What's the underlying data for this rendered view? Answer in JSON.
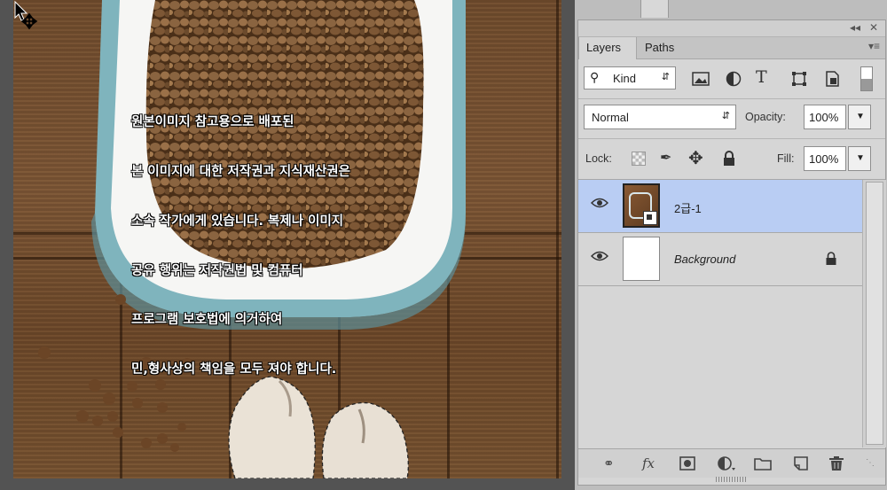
{
  "canvas": {
    "watermark_lines": [
      "원본이미지 참고용으로 배포된",
      "본 이미지에 대한 저작권과 지식재산권은",
      "소속 작가에게 있습니다. 복제나 이미지",
      "공유 행위는 저작권법 및 컴퓨터",
      "프로그램 보호법에 의거하여",
      "민,형사상의 책임을 모두 져야 합니다."
    ]
  },
  "panel": {
    "collapse_glyph": "◂◂",
    "close_glyph": "✕",
    "tabs": [
      {
        "label": "Layers",
        "active": true
      },
      {
        "label": "Paths",
        "active": false
      }
    ],
    "menu_glyph": "▾≡",
    "filter": {
      "kind_label": "Kind",
      "icons": [
        "image-filter-icon",
        "adjustment-filter-icon",
        "type-filter-icon",
        "shape-filter-icon",
        "smart-object-filter-icon"
      ]
    },
    "blend_mode": "Normal",
    "opacity_label": "Opacity:",
    "opacity_value": "100%",
    "lock_label": "Lock:",
    "fill_label": "Fill:",
    "fill_value": "100%",
    "layers": [
      {
        "name": "2급-1",
        "selected": true,
        "visible": true,
        "smart_object": true,
        "italic": false,
        "locked": false
      },
      {
        "name": "Background",
        "selected": false,
        "visible": true,
        "smart_object": false,
        "italic": true,
        "locked": true
      }
    ],
    "bottom_icons": [
      "link-layers-icon",
      "fx-icon",
      "add-mask-icon",
      "adjustment-layer-icon",
      "group-folder-icon",
      "new-layer-icon",
      "delete-layer-icon"
    ],
    "fx_label": "fx"
  },
  "colors": {
    "selected_row": "#b9cdf3",
    "panel_bg": "#d6d6d6"
  }
}
